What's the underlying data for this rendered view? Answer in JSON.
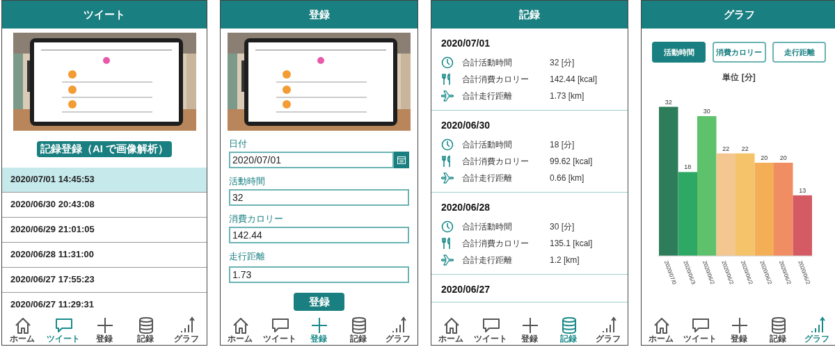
{
  "screens": [
    {
      "kind": "tweet",
      "title": "ツイート",
      "picture": {
        "kind": "picture"
      },
      "action": "記録登録（AI で画像解析）",
      "entries": [
        {
          "text": "2020/07/01 14:45:53",
          "selected": true
        },
        {
          "text": "2020/06/30 20:43:08",
          "selected": false
        },
        {
          "text": "2020/06/29 21:01:05",
          "selected": false
        },
        {
          "text": "2020/06/28 11:31:00",
          "selected": false
        },
        {
          "text": "2020/06/27 17:55:23",
          "selected": false
        },
        {
          "text": "2020/06/27 11:29:31",
          "selected": false
        }
      ],
      "nav": [
        {
          "kind": "home",
          "label": "ホーム",
          "selected": false
        },
        {
          "kind": "tweet",
          "label": "ツイート",
          "selected": true
        },
        {
          "kind": "add",
          "label": "登録",
          "selected": false
        },
        {
          "kind": "records",
          "label": "記録",
          "selected": false
        },
        {
          "kind": "graph",
          "label": "グラフ",
          "selected": false
        }
      ]
    },
    {
      "kind": "register",
      "title": "登録",
      "picture": {
        "kind": "picture"
      },
      "fields": [
        {
          "kind": "date",
          "label": "日付",
          "value": "2020/07/01"
        },
        {
          "kind": "text",
          "label": "活動時間",
          "value": "32"
        },
        {
          "kind": "text",
          "label": "消費カロリー",
          "value": "142.44"
        },
        {
          "kind": "text",
          "label": "走行距離",
          "value": "1.73"
        }
      ],
      "submit": "登録",
      "nav": [
        {
          "kind": "home",
          "label": "ホーム",
          "selected": false
        },
        {
          "kind": "tweet",
          "label": "ツイート",
          "selected": false
        },
        {
          "kind": "add",
          "label": "登録",
          "selected": true
        },
        {
          "kind": "records",
          "label": "記録",
          "selected": false
        },
        {
          "kind": "graph",
          "label": "グラフ",
          "selected": false
        }
      ]
    },
    {
      "kind": "records",
      "title": "記録",
      "records": [
        {
          "date": "2020/07/01",
          "items": [
            {
              "kind": "time",
              "label": "合計活動時間",
              "value": "32 [分]"
            },
            {
              "kind": "calorie",
              "label": "合計消費カロリー",
              "value": "142.44 [kcal]"
            },
            {
              "kind": "distance",
              "label": "合計走行距離",
              "value": "1.73 [km]"
            }
          ]
        },
        {
          "date": "2020/06/30",
          "items": [
            {
              "kind": "time",
              "label": "合計活動時間",
              "value": "18 [分]"
            },
            {
              "kind": "calorie",
              "label": "合計消費カロリー",
              "value": "99.62 [kcal]"
            },
            {
              "kind": "distance",
              "label": "合計走行距離",
              "value": "0.66 [km]"
            }
          ]
        },
        {
          "date": "2020/06/28",
          "items": [
            {
              "kind": "time",
              "label": "合計活動時間",
              "value": "30 [分]"
            },
            {
              "kind": "calorie",
              "label": "合計消費カロリー",
              "value": "135.1 [kcal]"
            },
            {
              "kind": "distance",
              "label": "合計走行距離",
              "value": "1.2 [km]"
            }
          ]
        },
        {
          "date": "2020/06/27"
        }
      ],
      "nav": [
        {
          "kind": "home",
          "label": "ホーム",
          "selected": false
        },
        {
          "kind": "tweet",
          "label": "ツイート",
          "selected": false
        },
        {
          "kind": "add",
          "label": "登録",
          "selected": false
        },
        {
          "kind": "records",
          "label": "記録",
          "selected": true
        },
        {
          "kind": "graph",
          "label": "グラフ",
          "selected": false
        }
      ]
    },
    {
      "kind": "graph",
      "title": "グラフ",
      "tabs": [
        {
          "label": "活動時間",
          "selected": true
        },
        {
          "label": "消費カロリー",
          "selected": false
        },
        {
          "label": "走行距離",
          "selected": false
        }
      ],
      "unit": "単位 [分]",
      "chart_data": {
        "type": "bar",
        "categories": [
          "2020/07/0",
          "2020/06/3",
          "2020/06/2",
          "2020/06/2",
          "2020/06/2",
          "2020/06/2",
          "2020/06/2",
          "2020/06/2"
        ],
        "series": [
          {
            "values": [
              32,
              18,
              30,
              22,
              22,
              20,
              20,
              13
            ]
          }
        ],
        "colors": [
          "#2e7d5a",
          "#2ea865",
          "#5ec16b",
          "#f4c690",
          "#f5c46a",
          "#f4af56",
          "#f18d62",
          "#d45b64"
        ],
        "data_labels": true
      },
      "nav": [
        {
          "kind": "home",
          "label": "ホーム",
          "selected": false
        },
        {
          "kind": "tweet",
          "label": "ツイート",
          "selected": false
        },
        {
          "kind": "add",
          "label": "登録",
          "selected": false
        },
        {
          "kind": "records",
          "label": "記録",
          "selected": false
        },
        {
          "kind": "graph",
          "label": "グラフ",
          "selected": true
        }
      ]
    }
  ]
}
